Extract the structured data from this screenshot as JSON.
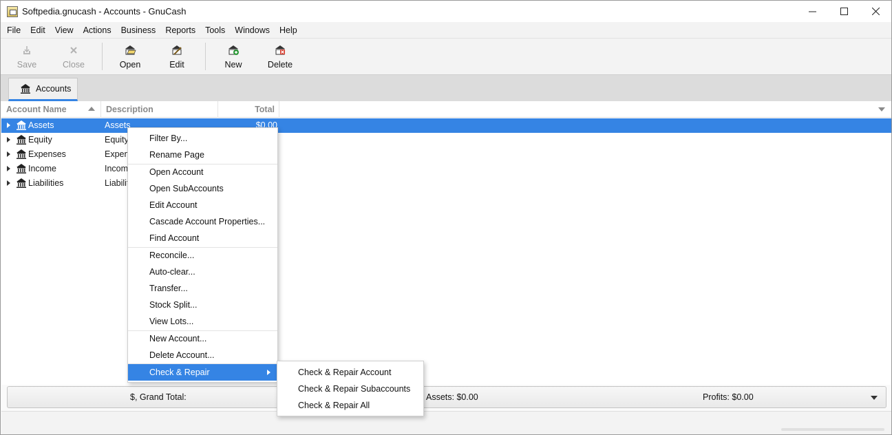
{
  "window": {
    "title": "Softpedia.gnucash - Accounts - GnuCash",
    "controls": {
      "minimize": "—",
      "maximize": "☐",
      "close": "✕"
    }
  },
  "menubar": [
    "File",
    "Edit",
    "View",
    "Actions",
    "Business",
    "Reports",
    "Tools",
    "Windows",
    "Help"
  ],
  "toolbar": {
    "save": {
      "label": "Save",
      "icon": "save-icon",
      "enabled": false
    },
    "close": {
      "label": "Close",
      "icon": "close-icon",
      "enabled": false
    },
    "open": {
      "label": "Open",
      "icon": "open-account-icon",
      "enabled": true
    },
    "edit": {
      "label": "Edit",
      "icon": "edit-account-icon",
      "enabled": true
    },
    "new": {
      "label": "New",
      "icon": "new-account-icon",
      "enabled": true
    },
    "delete": {
      "label": "Delete",
      "icon": "delete-account-icon",
      "enabled": true
    }
  },
  "tabs": [
    {
      "label": "Accounts",
      "icon": "bank-icon",
      "active": true
    }
  ],
  "tree": {
    "columns": {
      "name": "Account Name",
      "description": "Description",
      "total": "Total"
    },
    "rows": [
      {
        "name": "Assets",
        "description": "Assets",
        "total": "$0.00",
        "selected": true
      },
      {
        "name": "Equity",
        "description": "Equity",
        "total": "",
        "selected": false
      },
      {
        "name": "Expenses",
        "description": "Expens",
        "total": "",
        "selected": false
      },
      {
        "name": "Income",
        "description": "Income",
        "total": "",
        "selected": false
      },
      {
        "name": "Liabilities",
        "description": "Liabiliti",
        "total": "",
        "selected": false
      }
    ]
  },
  "context_menu": {
    "filter_by": "Filter By...",
    "rename_page": "Rename Page",
    "open_account": "Open Account",
    "open_subaccounts": "Open SubAccounts",
    "edit_account": "Edit Account",
    "cascade_props": "Cascade Account Properties...",
    "find_account": "Find Account",
    "reconcile": "Reconcile...",
    "auto_clear": "Auto-clear...",
    "transfer": "Transfer...",
    "stock_split": "Stock Split...",
    "view_lots": "View Lots...",
    "new_account": "New Account...",
    "delete_account": "Delete Account...",
    "check_repair": "Check & Repair"
  },
  "submenu": {
    "check_repair_account": "Check & Repair Account",
    "check_repair_subaccounts": "Check & Repair Subaccounts",
    "check_repair_all": "Check & Repair All"
  },
  "summary": {
    "grand_total": "$, Grand Total:",
    "assets": "Assets: $0.00",
    "profits": "Profits: $0.00"
  },
  "colors": {
    "accent": "#3584e4"
  }
}
